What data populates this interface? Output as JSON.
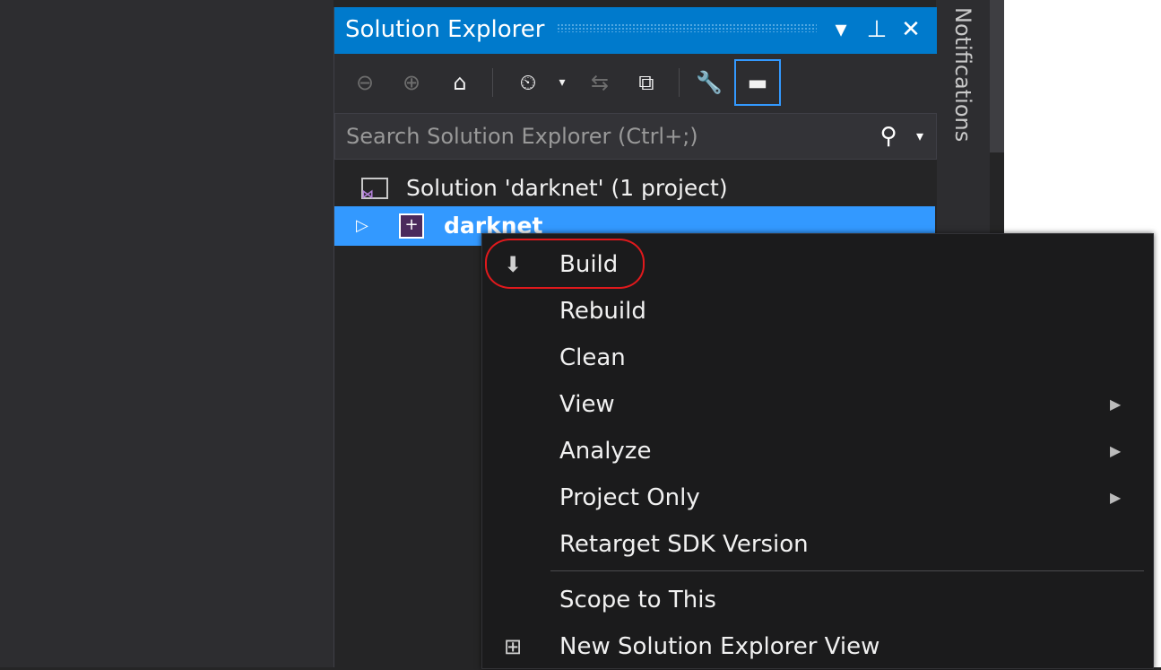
{
  "panel": {
    "title": "Solution Explorer",
    "title_buttons": {
      "dropdown": "▾",
      "pin": "⊥",
      "close": "✕"
    }
  },
  "toolbar": {
    "icons": [
      "back-icon",
      "forward-icon",
      "home-icon",
      "pending-changes-icon",
      "sync-icon",
      "collapse-all-icon",
      "properties-icon",
      "preview-icon"
    ]
  },
  "search": {
    "placeholder": "Search Solution Explorer (Ctrl+;)"
  },
  "tree": {
    "solution_label": "Solution 'darknet' (1 project)",
    "project_label": "darknet"
  },
  "context_menu": {
    "items": [
      {
        "label": "Build",
        "icon": "build-icon",
        "submenu": false
      },
      {
        "label": "Rebuild",
        "submenu": false
      },
      {
        "label": "Clean",
        "submenu": false
      },
      {
        "label": "View",
        "submenu": true
      },
      {
        "label": "Analyze",
        "submenu": true
      },
      {
        "label": "Project Only",
        "submenu": true
      },
      {
        "label": "Retarget SDK Version",
        "submenu": false
      },
      {
        "label": "Scope to This",
        "submenu": false
      },
      {
        "label": "New Solution Explorer View",
        "icon": "new-view-icon",
        "submenu": false
      }
    ],
    "submenu_arrow": "▶"
  },
  "notifications": {
    "label": "Notifications"
  },
  "colors": {
    "accent": "#007acc",
    "selection": "#3399ff",
    "highlight_ring": "#e0191c"
  }
}
